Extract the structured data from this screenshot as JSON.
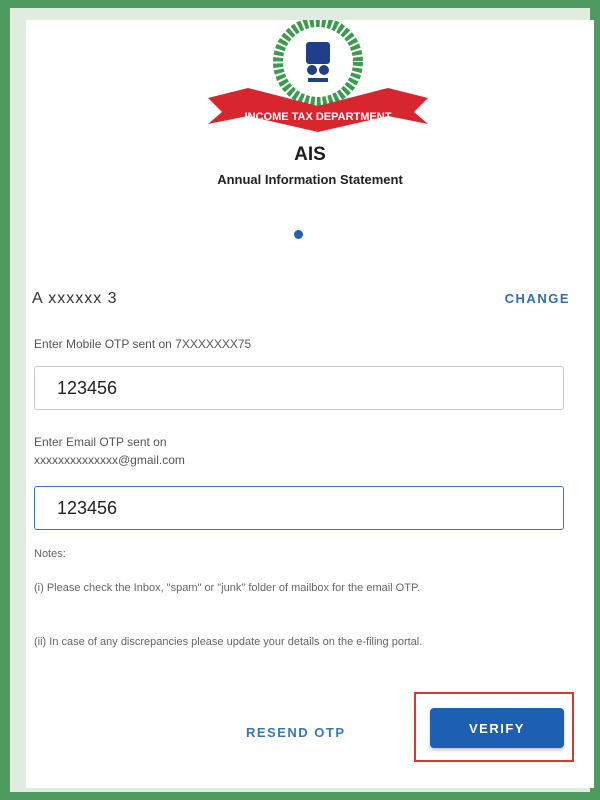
{
  "header": {
    "banner_text": "INCOME TAX DEPARTMENT",
    "title": "AIS",
    "subtitle": "Annual Information Statement"
  },
  "pan": {
    "value": "A  xxxxxx  3",
    "change_label": "CHANGE"
  },
  "mobile_otp": {
    "label": "Enter Mobile OTP sent on 7XXXXXXX75",
    "value": "123456"
  },
  "email_otp": {
    "label_line1": "Enter Email OTP sent on",
    "label_line2": "xxxxxxxxxxxxxx@gmail.com",
    "value": "123456"
  },
  "notes": {
    "heading": "Notes:",
    "items": [
      "(i) Please check the Inbox, \"spam\" or \"junk\" folder of mailbox for the email OTP.",
      "(ii) In case of any discrepancies please update your details on the e-filing portal."
    ]
  },
  "actions": {
    "resend_label": "RESEND OTP",
    "verify_label": "VERIFY"
  },
  "colors": {
    "accent": "#1d5fb3",
    "link": "#2f6fb0",
    "highlight": "#d63a2f",
    "border_green": "#4f9a5e"
  }
}
